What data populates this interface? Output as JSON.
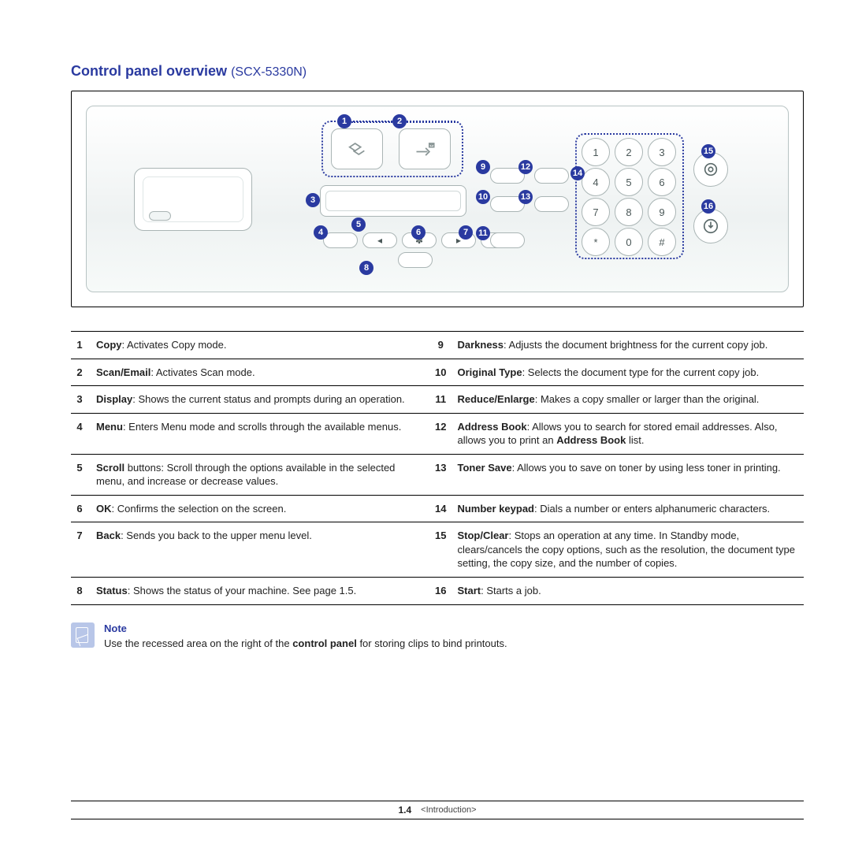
{
  "heading_main": "Control panel overview",
  "heading_model": "(SCX-5330N)",
  "keypad": [
    "1",
    "2",
    "3",
    "4",
    "5",
    "6",
    "7",
    "8",
    "9",
    "*",
    "0",
    "#"
  ],
  "callouts": {
    "c1": "1",
    "c2": "2",
    "c3": "3",
    "c4": "4",
    "c5": "5",
    "c6": "6",
    "c7": "7",
    "c8": "8",
    "c9": "9",
    "c10": "10",
    "c11": "11",
    "c12": "12",
    "c13": "13",
    "c14": "14",
    "c15": "15",
    "c16": "16"
  },
  "legend_left": [
    {
      "n": "1",
      "b": "Copy",
      "t": ": Activates Copy mode."
    },
    {
      "n": "2",
      "b": "Scan/Email",
      "t": ": Activates Scan mode."
    },
    {
      "n": "3",
      "b": "Display",
      "t": ": Shows the current status and prompts during an operation."
    },
    {
      "n": "4",
      "b": "Menu",
      "t": ": Enters Menu mode and scrolls through the available menus."
    },
    {
      "n": "5",
      "b": "Scroll",
      "t": " buttons: Scroll through the options available in the selected menu, and increase or decrease values."
    },
    {
      "n": "6",
      "b": "OK",
      "t": ": Confirms the selection on the screen."
    },
    {
      "n": "7",
      "b": "Back",
      "t": ": Sends you back to the upper menu level."
    },
    {
      "n": "8",
      "b": "Status",
      "t": ": Shows the status of your machine. See page 1.5."
    }
  ],
  "legend_right": [
    {
      "n": "9",
      "b": "Darkness",
      "t": ": Adjusts the document brightness for the current copy job."
    },
    {
      "n": "10",
      "b": "Original Type",
      "t": ": Selects the document type for the current copy job."
    },
    {
      "n": "11",
      "b": "Reduce/Enlarge",
      "t": ": Makes a copy smaller or larger than the original."
    },
    {
      "n": "12",
      "b": "Address Book",
      "t": ": Allows you to search for stored email addresses. Also, allows you to print an ",
      "b2": "Address Book",
      "t2": " list."
    },
    {
      "n": "13",
      "b": "Toner Save",
      "t": ": Allows you to save on toner by using less toner in printing."
    },
    {
      "n": "14",
      "b": "Number keypad",
      "t": ": Dials a number or enters alphanumeric characters."
    },
    {
      "n": "15",
      "b": "Stop/Clear",
      "t": ": Stops an operation at any time. In Standby mode, clears/cancels the copy options, such as the resolution, the document type setting, the copy size, and the number of copies."
    },
    {
      "n": "16",
      "b": "Start",
      "t": ": Starts a job."
    }
  ],
  "note_head": "Note",
  "note_body_pre": "Use the recessed area on the right of the ",
  "note_body_bold": "control panel",
  "note_body_post": " for storing clips to bind printouts.",
  "footer_page": "1.4",
  "footer_section": "<Introduction>"
}
